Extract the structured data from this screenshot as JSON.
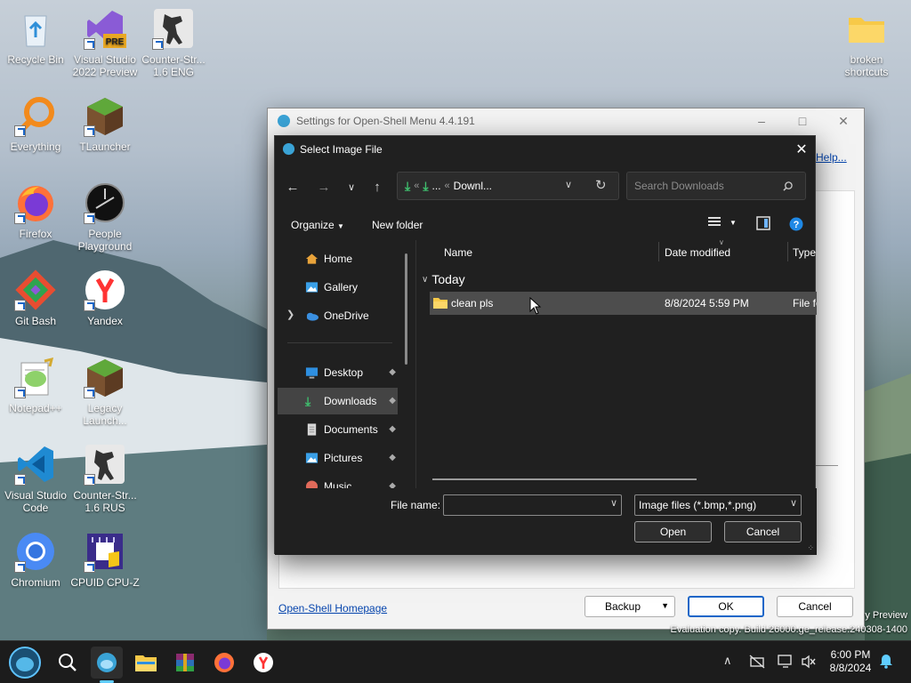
{
  "desktop": {
    "icons": [
      {
        "label": "Recycle Bin",
        "icon": "recycle-bin-icon"
      },
      {
        "label": "Visual Studio 2022 Preview",
        "icon": "visual-studio-icon"
      },
      {
        "label": "Counter-Str... 1.6 ENG",
        "icon": "counter-strike-icon"
      },
      {
        "label": "broken shortcuts",
        "icon": "folder-icon"
      },
      {
        "label": "Everything",
        "icon": "everything-search-icon"
      },
      {
        "label": "TLauncher",
        "icon": "minecraft-icon"
      },
      {
        "label": "Firefox",
        "icon": "firefox-icon"
      },
      {
        "label": "People Playground",
        "icon": "people-playground-icon"
      },
      {
        "label": "Git Bash",
        "icon": "git-bash-icon"
      },
      {
        "label": "Yandex",
        "icon": "yandex-icon"
      },
      {
        "label": "Notepad++",
        "icon": "notepad-plus-plus-icon"
      },
      {
        "label": "Legacy Launch...",
        "icon": "minecraft-icon"
      },
      {
        "label": "Visual Studio Code",
        "icon": "vscode-icon"
      },
      {
        "label": "Counter-Str... 1.6 RUS",
        "icon": "counter-strike-icon"
      },
      {
        "label": "Chromium",
        "icon": "chromium-icon"
      },
      {
        "label": "CPUID CPU-Z",
        "icon": "cpu-z-icon"
      }
    ],
    "watermark": {
      "line1": "y Preview",
      "line2": "Evaluation copy. Build 26000.ge_release.240308-1400"
    }
  },
  "settings_window": {
    "title": "Settings for Open-Shell Menu 4.4.191",
    "help_link": "Help...",
    "homepage_link": "Open-Shell Homepage",
    "backup_button": "Backup",
    "ok_button": "OK",
    "cancel_button": "Cancel"
  },
  "dialog": {
    "title": "Select Image File",
    "address": {
      "segment1": "...",
      "segment2": "Downl...",
      "separator": "«"
    },
    "search_placeholder": "Search Downloads",
    "toolbar": {
      "organize": "Organize",
      "new_folder": "New folder"
    },
    "nav_items": [
      {
        "label": "Home",
        "icon": "home-icon"
      },
      {
        "label": "Gallery",
        "icon": "gallery-icon"
      },
      {
        "label": "OneDrive",
        "icon": "onedrive-icon"
      },
      {
        "label": "Desktop",
        "icon": "desktop-icon"
      },
      {
        "label": "Downloads",
        "icon": "downloads-icon"
      },
      {
        "label": "Documents",
        "icon": "documents-icon"
      },
      {
        "label": "Pictures",
        "icon": "pictures-icon"
      },
      {
        "label": "Music",
        "icon": "music-icon"
      }
    ],
    "columns": {
      "name": "Name",
      "date_modified": "Date modified",
      "type": "Type"
    },
    "group_label": "Today",
    "files": [
      {
        "name": "clean pls",
        "date": "8/8/2024 5:59 PM",
        "type": "File fo"
      }
    ],
    "file_name_label": "File name:",
    "file_name_value": "",
    "filter": "Image files (*.bmp,*.png)",
    "open_button": "Open",
    "cancel_button": "Cancel"
  },
  "taskbar": {
    "time": "6:00 PM",
    "date": "8/8/2024",
    "apps": [
      "open-shell-start-icon",
      "search-icon",
      "open-shell-icon",
      "file-explorer-icon",
      "winrar-icon",
      "firefox-icon",
      "yandex-icon"
    ]
  }
}
